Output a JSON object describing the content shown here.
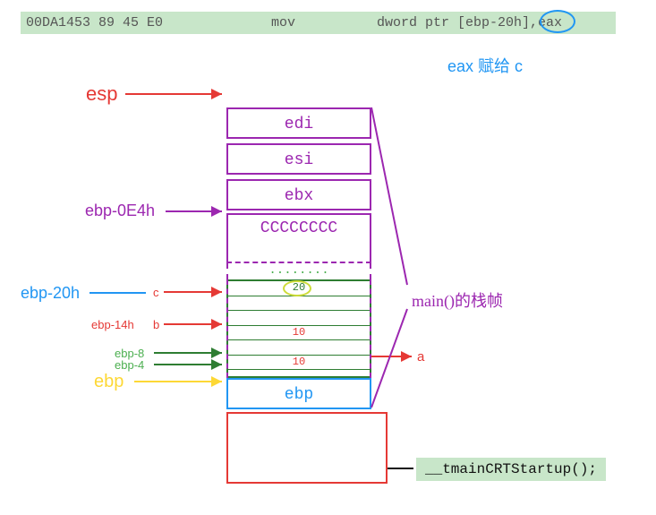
{
  "asm": {
    "addr": "00DA1453 89 45 E0",
    "mnemonic": "mov",
    "operands": "dword ptr [ebp-20h],eax"
  },
  "annotation": "eax 赋给 c",
  "labels": {
    "esp": "esp",
    "ebp_0e4h": "ebp-0E4h",
    "ebp_20h": "ebp-20h",
    "c": "c",
    "ebp_14h": "ebp-14h",
    "b": "b",
    "ebp_8": "ebp-8",
    "ebp_4": "ebp-4",
    "ebp": "ebp",
    "a": "a",
    "main_frame": "main()的栈帧",
    "startup": "__tmainCRTStartup();"
  },
  "cells": {
    "edi": "edi",
    "esi": "esi",
    "ebx": "ebx",
    "cc": "CCCCCCCC",
    "dots": "........",
    "val20": "20",
    "val10a": "10",
    "val10b": "10",
    "ebp": "ebp"
  }
}
